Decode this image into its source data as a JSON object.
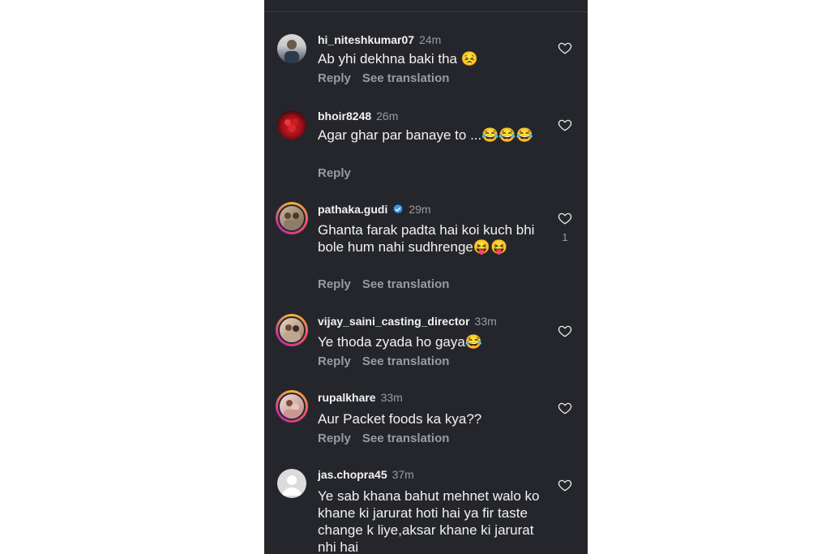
{
  "comments": [
    {
      "username": "hi_niteshkumar07",
      "time": "24m",
      "text": "Ab yhi dekhna baki tha 😣",
      "reply": "Reply",
      "translate": "See translation",
      "likes": ""
    },
    {
      "username": "bhoir8248",
      "time": "26m",
      "text": "Agar ghar par banaye to ...😂😂😂",
      "reply": "Reply",
      "translate": "",
      "likes": ""
    },
    {
      "username": "pathaka.gudi",
      "time": "29m",
      "text": "Ghanta farak padta hai koi kuch bhi bole hum nahi sudhrenge😝😝",
      "reply": "Reply",
      "translate": "See translation",
      "likes": "1"
    },
    {
      "username": "vijay_saini_casting_director",
      "time": "33m",
      "text": "Ye thoda zyada ho gaya😂",
      "reply": "Reply",
      "translate": "See translation",
      "likes": ""
    },
    {
      "username": "rupalkhare",
      "time": "33m",
      "text": "Aur Packet foods ka kya??",
      "reply": "Reply",
      "translate": "See translation",
      "likes": ""
    },
    {
      "username": "jas.chopra45",
      "time": "37m",
      "text": "Ye sab khana bahut mehnet walo ko khane ki jarurat hoti hai ya fir taste change k liye,aksar khane ki jarurat nhi hai",
      "reply": "",
      "translate": "",
      "likes": ""
    }
  ],
  "icons": {
    "like": "heart-outline-icon",
    "verified": "verified-badge-icon"
  },
  "colors": {
    "background": "#25262b",
    "text": "#f2f2f2",
    "muted": "#9a9ba0",
    "verified": "#3897f0"
  }
}
